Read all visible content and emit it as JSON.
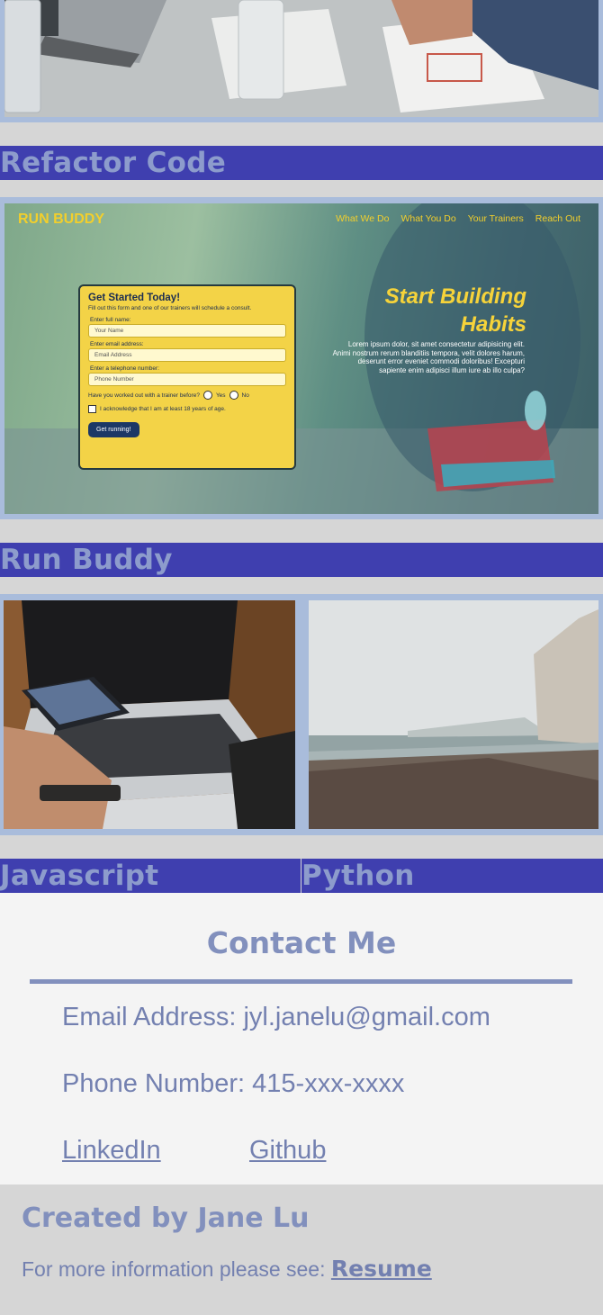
{
  "projects": [
    {
      "title": "Refactor Code",
      "image": "meeting-laptop-photo"
    },
    {
      "title": "Run Buddy",
      "image": "run-buddy-screenshot"
    },
    {
      "title": "Javascript",
      "image": "laptop-phone-photo"
    },
    {
      "title": "Python",
      "image": "foggy-beach-photo"
    }
  ],
  "run_buddy": {
    "logo": "RUN BUDDY",
    "nav": [
      "What We Do",
      "What You Do",
      "Your Trainers",
      "Reach Out"
    ],
    "hero_title_1": "Start Building",
    "hero_title_2": "Habits",
    "hero_text": "Lorem ipsum dolor, sit amet consectetur adipisicing elit. Animi nostrum rerum blanditiis tempora, velit dolores harum, deserunt error eveniet commodi doloribus! Excepturi sapiente enim adipisci illum iure ab illo culpa?",
    "form": {
      "title": "Get Started Today!",
      "subtitle": "Fill out this form and one of our trainers will schedule a consult.",
      "name_label": "Enter full name:",
      "name_placeholder": "Your Name",
      "email_label": "Enter email address:",
      "email_placeholder": "Email Address",
      "phone_label": "Enter a telephone number:",
      "phone_placeholder": "Phone Number",
      "question": "Have you worked out with a trainer before?",
      "yes": "Yes",
      "no": "No",
      "acknowledge": "I acknowledge that I am at least 18 years of age.",
      "button": "Get running!"
    }
  },
  "contact": {
    "title": "Contact Me",
    "email": "Email Address: jyl.janelu@gmail.com",
    "phone": "Phone Number: 415-xxx-xxxx",
    "linkedin": "LinkedIn",
    "github": "Github"
  },
  "footer": {
    "title": "Created by Jane Lu",
    "text": "For more information please see:",
    "resume": "Resume"
  },
  "colors": {
    "bar": "#3f3faf",
    "bar_text": "#8d9ccc",
    "frame": "#a9bcdb",
    "accent": "#8290bd"
  }
}
